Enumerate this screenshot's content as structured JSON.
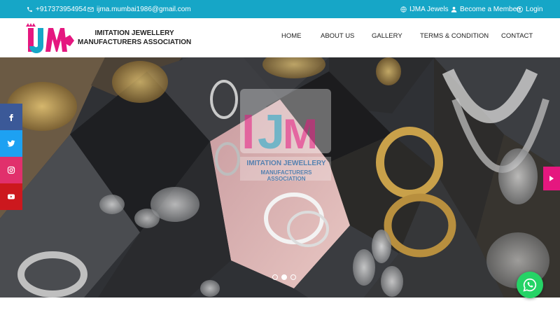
{
  "topbar": {
    "phone": "+917373954954",
    "email": "ijma.mumbai1986@gmail.com",
    "link_jewels": "IJMA Jewels",
    "link_member": "Become a Member",
    "link_login": "Login"
  },
  "brand": {
    "logo_text": "IJM",
    "line1": "IMITATION JEWELLERY",
    "line2": "MANUFACTURERS ASSOCIATION"
  },
  "nav": [
    "HOME",
    "ABOUT US",
    "GALLERY",
    "TERMS & CONDITION",
    "CONTACT"
  ],
  "hero": {
    "watermark_line1": "IMITATION JEWELLERY",
    "watermark_line2": "MANUFACTURERS ASSOCIATION",
    "slides_total": 3,
    "slide_active": 2
  },
  "social": [
    "facebook-icon",
    "twitter-icon",
    "instagram-icon",
    "youtube-icon"
  ],
  "colors": {
    "topbar": "#16a6c7",
    "accent": "#e5177f",
    "facebook": "#3b5998",
    "twitter": "#1da1f2",
    "instagram": "#e1306c",
    "youtube": "#cc181e",
    "whatsapp": "#25d366"
  }
}
